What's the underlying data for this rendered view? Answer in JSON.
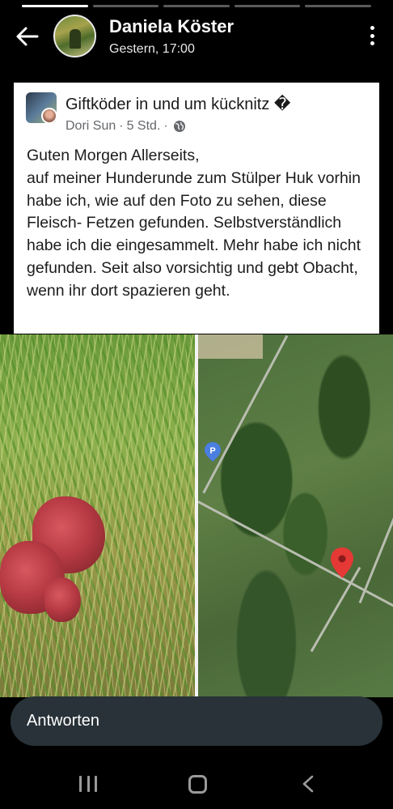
{
  "story": {
    "progress_segments": 5,
    "progress_completed": 1,
    "author_name": "Daniela Köster",
    "timestamp": "Gestern, 17:00",
    "icons": {
      "back": "arrow-left-icon",
      "more": "more-vertical-icon"
    }
  },
  "shared_post": {
    "group_name": "Giftköder in und um kücknitz",
    "group_name_suffix": "�",
    "poster": "Dori Sun",
    "time": "5 Std.",
    "separator": "·",
    "visibility_icon": "globe-icon",
    "text": "Guten Morgen Allerseits,\nauf meiner Hunderunde zum Stülper Huk vorhin habe ich, wie auf den Foto zu sehen, diese Fleisch- Fetzen gefunden. Selbstverständlich habe ich die eingesammelt. Mehr habe ich nicht gefunden. Seit also vorsichtig und gebt Obacht, wenn ihr dort spazieren geht."
  },
  "photos": {
    "left": "grass-with-meat-photo",
    "right": "satellite-map-photo",
    "map_markers": {
      "parking": "P",
      "location": "red-location-pin-icon"
    }
  },
  "reply": {
    "placeholder": "Antworten"
  },
  "navbar": {
    "icons": [
      "recent-apps-icon",
      "home-icon",
      "back-icon"
    ]
  },
  "colors": {
    "reply_bg": "#283238",
    "pin_red": "#e53935",
    "parking_blue": "#4a7ee0"
  }
}
